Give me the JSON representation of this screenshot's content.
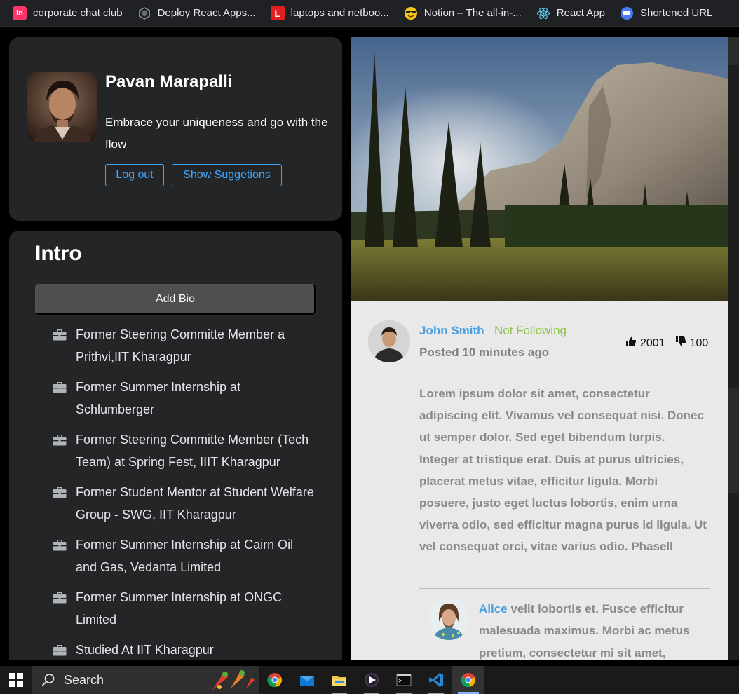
{
  "bookmarks": [
    {
      "label": "corporate chat club",
      "icon": "invision-icon",
      "color": "#ff3366"
    },
    {
      "label": "Deploy React Apps...",
      "icon": "netlify-hex-icon",
      "color": "#6b6f7a"
    },
    {
      "label": "laptops and netboo...",
      "icon": "letter-l-icon",
      "color": "#e02020"
    },
    {
      "label": "Notion – The all-in-...",
      "icon": "sunglasses-emoji-icon",
      "color": "#f5c518"
    },
    {
      "label": "React App",
      "icon": "react-icon",
      "color": "#61dafb"
    },
    {
      "label": "Shortened URL",
      "icon": "chat-bubble-icon",
      "color": "#4a7cf7"
    }
  ],
  "profile": {
    "name": "Pavan Marapalli",
    "tagline": "Embrace your uniqueness and go with the flow",
    "logout_label": "Log out",
    "suggestions_label": "Show Suggetions"
  },
  "intro": {
    "title": "Intro",
    "add_bio_label": "Add Bio",
    "items": [
      "Former Steering Committe Member a Prithvi,IIT Kharagpur",
      "Former Summer Internship at Schlumberger",
      "Former Steering Committe Member (Tech Team) at Spring Fest, IIIT Kharagpur",
      "Former Student Mentor at Student Welfare Group - SWG, IIT Kharagpur",
      "Former Summer Internship at Cairn Oil and Gas, Vedanta Limited",
      "Former Summer Internship at ONGC Limited",
      "Studied At IIT Kharagpur"
    ]
  },
  "post": {
    "author": "John Smith",
    "follow_status": "Not Following",
    "time": "Posted 10 minutes ago",
    "likes": "2001",
    "dislikes": "100",
    "body": "Lorem ipsum dolor sit amet, consectetur adipiscing elit. Vivamus vel consequat nisi. Donec ut semper dolor. Sed eget bibendum turpis. Integer at tristique erat. Duis at purus ultricies, placerat metus vitae, efficitur ligula. Morbi posuere, justo eget luctus lobortis, enim urna viverra odio, sed efficitur magna purus id ligula. Ut vel consequat orci, vitae varius odio. Phasell",
    "comment": {
      "author": "Alice",
      "text": " velit lobortis et. Fusce efficitur malesuada maximus. Morbi ac metus pretium, consectetur mi sit amet,"
    }
  },
  "taskbar": {
    "search_label": "Search",
    "apps": [
      "chrome-icon",
      "mail-icon",
      "file-explorer-icon",
      "media-player-icon",
      "terminal-icon",
      "vscode-icon",
      "chrome-active-icon"
    ]
  }
}
